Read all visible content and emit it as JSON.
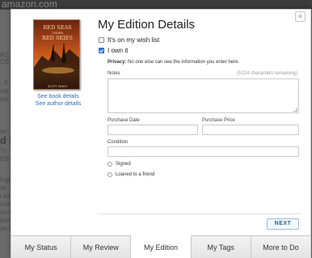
{
  "background": {
    "logo": "amazon.com",
    "fragments": [
      "RS",
      "CS",
      "; S",
      "sat",
      "ets",
      "ter",
      "d Se",
      "7)",
      "Eth",
      "high",
      "ra ,",
      "i sa",
      "ccid",
      "ou o",
      "kinc",
      "ue d"
    ]
  },
  "modal": {
    "close_glyph": "×",
    "title": "My Edition Details",
    "wish_list_label": "It's on my wish list",
    "wish_list_checked": false,
    "own_it_label": "I own it",
    "own_it_checked": true,
    "privacy_bold": "Privacy:",
    "privacy_text": " No one else can see the information you enter here.",
    "notes_label": "Notes",
    "notes_remaining": "(1024 characters remaining)",
    "notes_value": "",
    "purchase_date_label": "Purchase Date",
    "purchase_date_value": "",
    "purchase_price_label": "Purchase Price",
    "purchase_price_value": "",
    "condition_label": "Condition",
    "condition_value": "",
    "signed_label": "Signed",
    "loaned_label": "Loaned to a friend",
    "next_label": "NEXT"
  },
  "book": {
    "cover_title_line1": "RED SEAS",
    "cover_title_line2": "UNDER",
    "cover_title_line3": "RED SKIES",
    "cover_author": "SCOTT LYNCH",
    "see_book_details": "See book details",
    "see_author_details": "See author details"
  },
  "tabs": [
    {
      "label": "My Status",
      "active": false
    },
    {
      "label": "My Review",
      "active": false
    },
    {
      "label": "My Edition",
      "active": true
    },
    {
      "label": "My Tags",
      "active": false
    },
    {
      "label": "More to Do",
      "active": false
    }
  ],
  "colors": {
    "link": "#2b6cb0",
    "checkbox_checked": "#3b7dd8",
    "next_text": "#2d6796"
  }
}
